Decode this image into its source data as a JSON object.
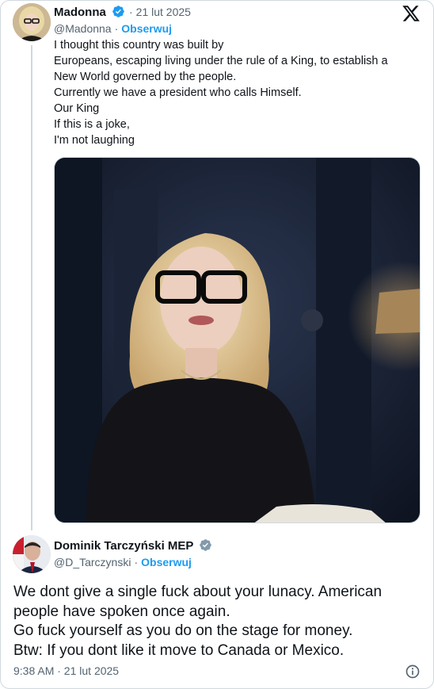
{
  "original_tweet": {
    "author_name": "Madonna",
    "date": "21 lut 2025",
    "handle": "@Madonna",
    "follow_label": "Obserwuj",
    "text_lines": [
      "I thought this country was built by",
      "Europeans, escaping living under the rule of a King, to establish a",
      "New World governed by the people.",
      "Currently we have a president who calls Himself.",
      "Our King",
      "If this is a joke,",
      "I'm not laughing"
    ],
    "badge_color": "#1d9bf0"
  },
  "reply_tweet": {
    "author_name": "Dominik Tarczyński MEP",
    "handle": "@D_Tarczynski",
    "follow_label": "Obserwuj",
    "badge_color": "#829aab",
    "text_lines": [
      "We dont give a single fuck about your lunacy. American",
      "people have spoken once again.",
      "Go fuck yourself as you do on the stage for money.",
      "Btw: If you dont like it move to Canada or Mexico."
    ],
    "timestamp": "9:38 AM · 21 lut 2025"
  },
  "icons": {
    "brand": "x-logo-icon",
    "info": "info-icon",
    "verified": "verified-badge-icon"
  },
  "colors": {
    "link": "#1d9bf0",
    "secondary_text": "#536471",
    "border": "#cfd9de"
  }
}
